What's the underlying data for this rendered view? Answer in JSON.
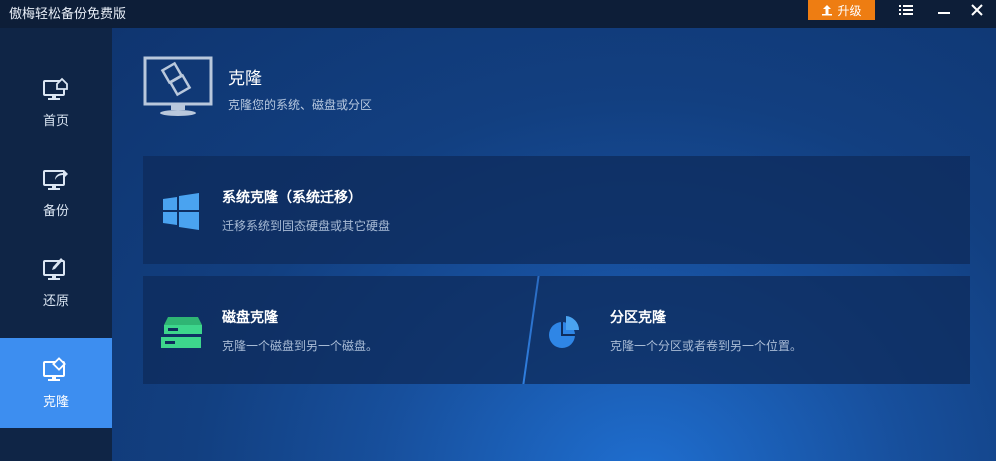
{
  "app": {
    "title": "傲梅轻松备份免费版",
    "upgrade_label": "升级"
  },
  "window_controls": [
    "menu-icon",
    "minimize-icon",
    "close-icon"
  ],
  "sidebar": {
    "items": [
      {
        "label": "首页",
        "icon": "home-monitor-icon",
        "active": false
      },
      {
        "label": "备份",
        "icon": "backup-monitor-icon",
        "active": false
      },
      {
        "label": "还原",
        "icon": "restore-monitor-icon",
        "active": false
      },
      {
        "label": "克隆",
        "icon": "clone-monitor-icon",
        "active": true
      }
    ]
  },
  "header": {
    "title": "克隆",
    "subtitle": "克隆您的系统、磁盘或分区"
  },
  "options": {
    "system": {
      "title": "系统克隆（系统迁移）",
      "desc": "迁移系统到固态硬盘或其它硬盘",
      "icon": "windows-icon"
    },
    "disk": {
      "title": "磁盘克隆",
      "desc": "克隆一个磁盘到另一个磁盘。",
      "icon": "disk-clone-icon"
    },
    "partition": {
      "title": "分区克隆",
      "desc": "克隆一个分区或者卷到另一个位置。",
      "icon": "partition-pie-icon"
    }
  },
  "colors": {
    "accent_active": "#3d8ef0",
    "upgrade": "#ee7d12",
    "disk_icon": "#3dd68c",
    "system_icon": "#4aa3f0",
    "partition_icon": "#2f86e6"
  }
}
